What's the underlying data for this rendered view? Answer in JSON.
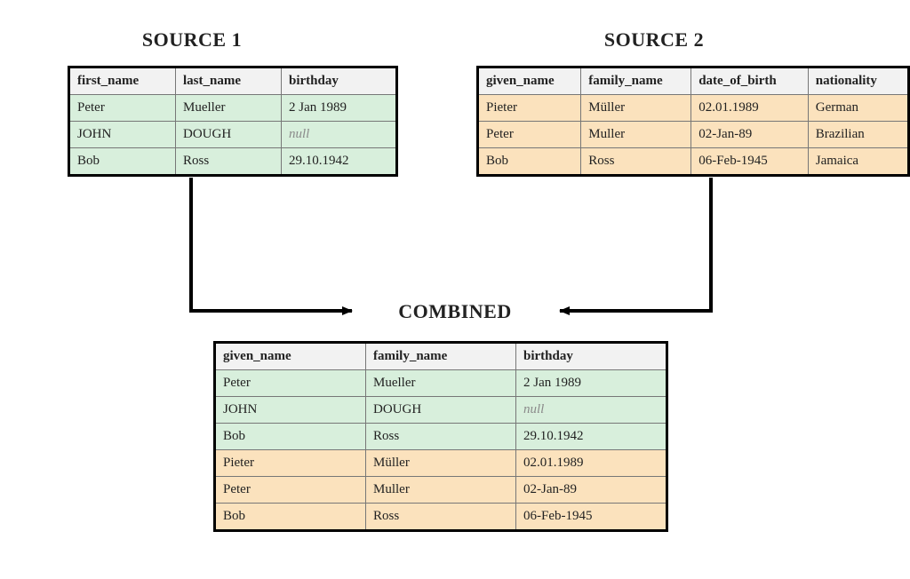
{
  "titles": {
    "source1": "SOURCE 1",
    "source2": "SOURCE 2",
    "combined": "COMBINED"
  },
  "colors": {
    "green": "#d8efdc",
    "tan": "#fbe2bd",
    "header": "#f2f2f2",
    "null_text": "#8a8a8a",
    "border": "#000000"
  },
  "source1": {
    "headers": [
      "first_name",
      "last_name",
      "birthday"
    ],
    "rows": [
      {
        "color": "green",
        "cells": [
          "Peter",
          "Mueller",
          "2 Jan 1989"
        ]
      },
      {
        "color": "green",
        "cells": [
          "JOHN",
          "DOUGH",
          null
        ]
      },
      {
        "color": "green",
        "cells": [
          "Bob",
          "Ross",
          "29.10.1942"
        ]
      }
    ]
  },
  "source2": {
    "headers": [
      "given_name",
      "family_name",
      "date_of_birth",
      "nationality"
    ],
    "rows": [
      {
        "color": "tan",
        "cells": [
          "Pieter",
          "Müller",
          "02.01.1989",
          "German"
        ]
      },
      {
        "color": "tan",
        "cells": [
          "Peter",
          "Muller",
          "02-Jan-89",
          "Brazilian"
        ]
      },
      {
        "color": "tan",
        "cells": [
          "Bob",
          "Ross",
          "06-Feb-1945",
          "Jamaica"
        ]
      }
    ]
  },
  "combined": {
    "headers": [
      "given_name",
      "family_name",
      "birthday"
    ],
    "rows": [
      {
        "color": "green",
        "cells": [
          "Peter",
          "Mueller",
          "2 Jan 1989"
        ]
      },
      {
        "color": "green",
        "cells": [
          "JOHN",
          "DOUGH",
          null
        ]
      },
      {
        "color": "green",
        "cells": [
          "Bob",
          "Ross",
          "29.10.1942"
        ]
      },
      {
        "color": "tan",
        "cells": [
          "Pieter",
          "Müller",
          "02.01.1989"
        ]
      },
      {
        "color": "tan",
        "cells": [
          "Peter",
          "Muller",
          "02-Jan-89"
        ]
      },
      {
        "color": "tan",
        "cells": [
          "Bob",
          "Ross",
          "06-Feb-1945"
        ]
      }
    ]
  },
  "null_label": "null",
  "column_widths": {
    "source1": [
      100,
      100,
      110
    ],
    "source2": [
      110,
      120,
      130,
      110
    ],
    "combined": [
      150,
      150,
      150
    ]
  }
}
